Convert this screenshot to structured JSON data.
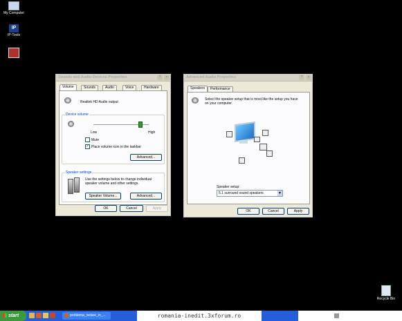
{
  "desktop": {
    "icons": [
      {
        "label": "My Computer",
        "icon": "my-computer-icon"
      },
      {
        "label": "IP-Tools",
        "icon": "ip-tools-icon",
        "badge": "IP"
      },
      {
        "label": "",
        "icon": "app-shortcut-icon"
      },
      {
        "label": "Recycle Bin",
        "icon": "recycle-bin-icon"
      }
    ]
  },
  "sounds_window": {
    "title": "Sounds and Audio Devices Properties",
    "tabs": [
      "Volume",
      "Sounds",
      "Audio",
      "Voice",
      "Hardware"
    ],
    "active_tab": "Volume",
    "device_name": "Realtek HD Audio output",
    "device_volume": {
      "label": "Device volume",
      "low": "Low",
      "high": "High",
      "level": 0.85,
      "mute_label": "Mute",
      "mute_checked": false,
      "tray_label": "Place volume icon in the taskbar",
      "tray_checked": true,
      "advanced_button": "Advanced..."
    },
    "speaker_settings": {
      "label": "Speaker settings",
      "description": "Use the settings below to change individual speaker volume and other settings.",
      "speaker_volume_button": "Speaker Volume...",
      "advanced_button": "Advanced..."
    },
    "buttons": {
      "ok": "OK",
      "cancel": "Cancel",
      "apply": "Apply"
    }
  },
  "advanced_window": {
    "title": "Advanced Audio Properties",
    "tabs": [
      "Speakers",
      "Performance"
    ],
    "active_tab": "Speakers",
    "instruction": "Select the speaker setup that is most like the setup you have on your computer.",
    "speaker_setup_label": "Speaker setup:",
    "speaker_setup_value": "5.1 surround sound speakers",
    "buttons": {
      "ok": "OK",
      "cancel": "Cancel",
      "apply": "Apply"
    }
  },
  "taskbar": {
    "start_label": "start",
    "task_label": "problema_redare_in_...",
    "watermark": "romania-inedit.3xforum.ro"
  }
}
